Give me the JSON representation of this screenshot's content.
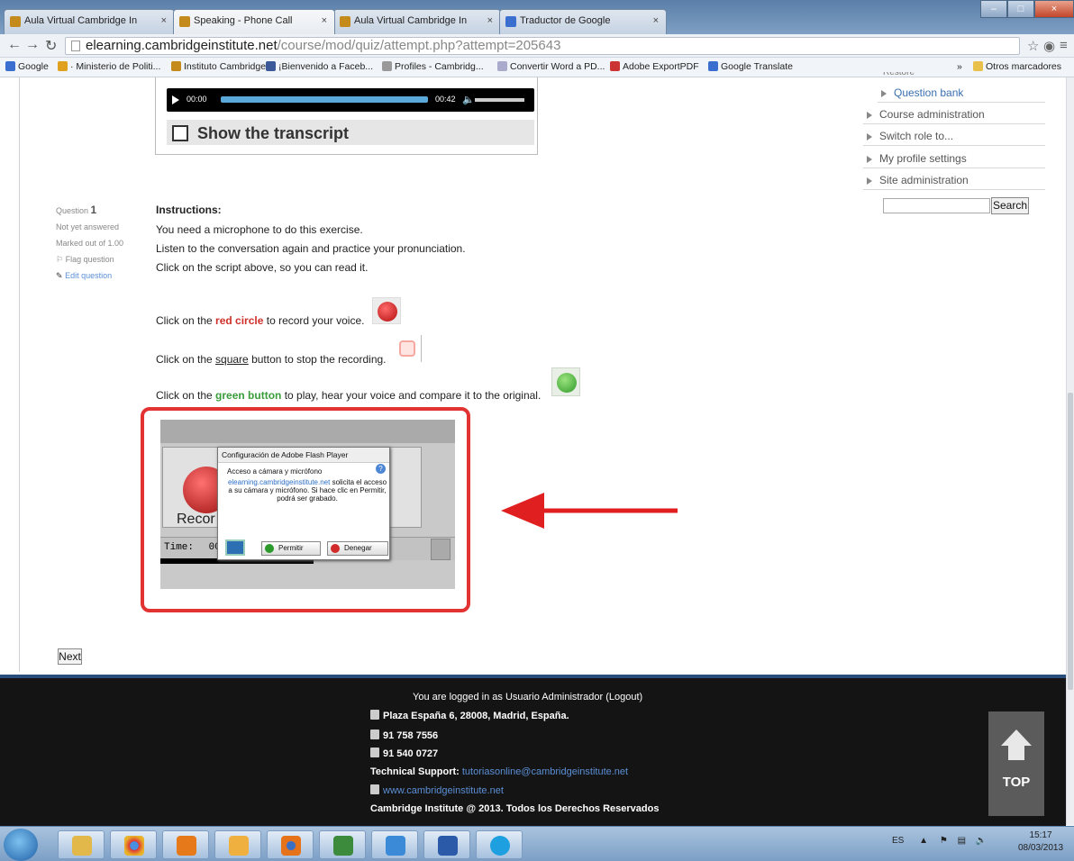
{
  "browser": {
    "tabs": [
      {
        "title": "Aula Virtual Cambridge In"
      },
      {
        "title": "Speaking - Phone Call"
      },
      {
        "title": "Aula Virtual Cambridge In"
      },
      {
        "title": "Traductor de Google"
      }
    ],
    "url_host": "elearning.cambridgeinstitute.net",
    "url_path": "/course/mod/quiz/attempt.php?attempt=205643",
    "bookmarks": [
      "Google",
      "· Ministerio de Politi...",
      "Instituto Cambridge",
      "¡Bienvenido a Faceb...",
      "Profiles - Cambridg...",
      "Convertir Word a PD...",
      "Adobe ExportPDF",
      "Google Translate"
    ],
    "bookmarks_overflow": "»",
    "other_bookmarks": "Otros marcadores"
  },
  "player": {
    "time_start": "00:00",
    "time_end": "00:42"
  },
  "transcript_label": "Show the transcript",
  "sidebar": {
    "restore": "Restore",
    "items": [
      "Question bank",
      "Course administration",
      "Switch role to...",
      "My profile settings",
      "Site administration"
    ],
    "search_button": "Search"
  },
  "question": {
    "label": "Question",
    "number": "1",
    "status": "Not yet answered",
    "marks": "Marked out of 1.00",
    "flag": "Flag question",
    "edit": "Edit question"
  },
  "instructions": {
    "heading": "Instructions:",
    "lines": [
      "You need a microphone to do this exercise.",
      "Listen to the conversation again and practice your pronunciation.",
      "Click on the script above, so you can read it."
    ],
    "red_pre": "Click on the ",
    "red_word": "red circle",
    "red_post": " to record your voice.",
    "sq_pre": "Click on the ",
    "sq_word": "square",
    "sq_post": " button to stop the recording.",
    "green_pre": "Click on the ",
    "green_word": "green button",
    "green_post": " to play, hear your voice and compare it to the original."
  },
  "flash": {
    "record_label": "Recor",
    "time_label": "Time:",
    "time_value": "00",
    "dialog_title": "Configuración de Adobe Flash Player",
    "dialog_subtitle": "Acceso a cámara y micrófono",
    "dialog_link": "elearning.cambridgeinstitute.net",
    "dialog_text": "solicita el acceso a su cámara y micrófono. Si hace clic en Permitir, podrá ser grabado.",
    "allow": "Permitir",
    "deny": "Denegar"
  },
  "next_button": "Next",
  "footer": {
    "logged_in": "You are logged in as Usuario Administrador (Logout)",
    "address": "Plaza España 6, 28008, Madrid, España.",
    "phone": "91 758 7556",
    "fax": "91 540 0727",
    "support_label": "Technical Support:",
    "support_email": "tutoriasonline@cambridgeinstitute.net",
    "website": "www.cambridgeinstitute.net",
    "copyright": "Cambridge Institute @ 2013. Todos los Derechos Reservados",
    "top_label": "TOP"
  },
  "taskbar": {
    "lang": "ES",
    "time": "15:17",
    "date": "08/03/2013"
  },
  "colors": {
    "accent_red": "#e23232",
    "footer_bg": "#141414",
    "link_blue": "#2a6ec7"
  }
}
